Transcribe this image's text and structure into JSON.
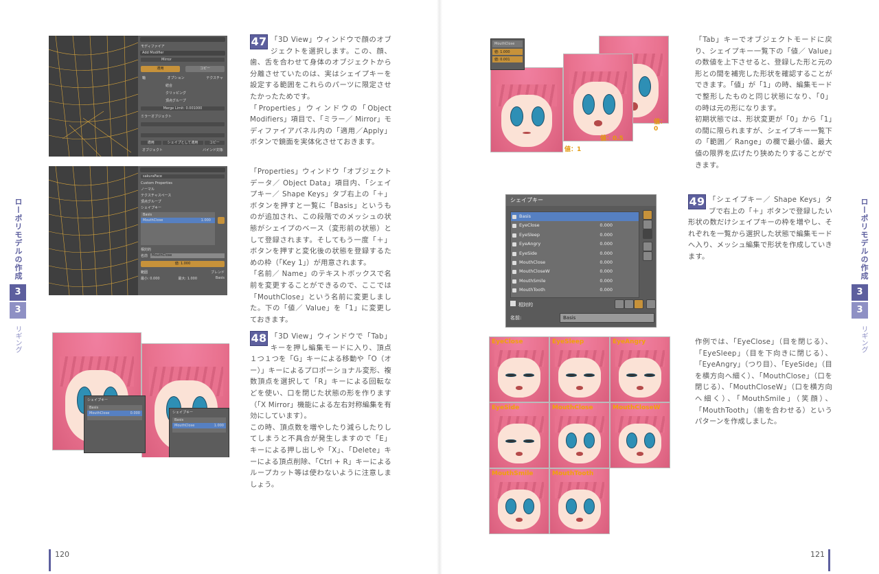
{
  "left_page": {
    "page_number": "120",
    "side_title": "ローポリモデルの作成",
    "chapter": "3",
    "section": "3",
    "side_subtitle": "リギング",
    "step47": {
      "number": "47",
      "para1": "「3D View」ウィンドウで顔のオブジェクトを選択します。この、顔、歯、舌を合わせて身体のオブジェクトから分離させていたのは、実はシェイプキーを設定する範囲をこれらのパーツに限定させたかったためです。",
      "para2": "「Properties」ウィンドウの「Object Modifiers」項目で、「ミラー／ Mirror」モディファイアパネル内の「適用／Apply」ボタンで鏡面を実体化させておきます。"
    },
    "step47b": {
      "para1": "「Properties」ウィンドウ「オブジェクトデータ／ Object Data」項目内、「シェイプキー／ Shape Keys」タブ右上の「＋」ボタンを押すと一覧に「Basis」というものが追加され、この段階でのメッシュの状態がシェイプのベース（変形前の状態）として登録されます。そしてもう一度「＋」ボタンを押すと変化後の状態を登録するための枠（「Key 1」）が用意されます。",
      "para2": "「名前／ Name」のテキストボックスで名前を変更することができるので、ここでは「MouthClose」という名前に変更しました。下の「値／ Value」を「1」に変更しておきます。"
    },
    "step48": {
      "number": "48",
      "para1": "「3D View」ウィンドウで「Tab」キーを押し編集モードに入り、頂点１つ１つを「G」キーによる移動や「O（オー）」キーによるプロポーショナル変形、複数頂点を選択して「R」キーによる回転などを使い、口を閉じた状態の形を作ります（「X Mirror」機能による左右対称編集を有効にしています）。",
      "para2": "この時、頂点数を増やしたり減らしたりしてしまうと不具合が発生しますので「E」キーによる押し出しや「X」、「Delete」キーによる頂点削除、「Ctrl + R」キーによるループカット等は使わないように注意しましょう。"
    },
    "ui": {
      "modifier_header": "モディファイア",
      "add_modifier": "Add Modifier",
      "mirror_name": "Mirror",
      "apply": "適用",
      "copy": "コピー",
      "axis": "軸",
      "options": "オプション",
      "texture": "テクスチャ",
      "merge": "結合",
      "clipping": "クリッピング",
      "vertex_group": "頂点グループ",
      "merge_limit": "Merge Limit: 0.001000",
      "mirror_object": "ミラーオブジェクト",
      "shape_apply": "シェイプとして適用",
      "object_label": "オブジェクト",
      "bind_label": "バインド対象",
      "object_name": "sakuraFace",
      "custom_props": "Custom Properties",
      "normals": "ノーマル",
      "texture_space": "テクスチャスペース",
      "vertex_groups": "頂点グループ",
      "shape_keys": "シェイプキー",
      "basis": "Basis",
      "mouth_close": "MouthClose",
      "mouth_value": "1.000",
      "relative": "相対的",
      "name_label": "名前",
      "value_label": "値: 1.000",
      "range_label": "範囲",
      "blend_label": "ブレンド",
      "min_label": "最小: 0.000",
      "max_label": "最大: 1.000",
      "blend_basis": "Basis",
      "shape_key_small": "シェイプキー",
      "value_small": "0.000"
    }
  },
  "right_page": {
    "page_number": "121",
    "side_title": "ローポリモデルの作成",
    "chapter": "3",
    "section": "3",
    "side_subtitle": "リギング",
    "tab_text": {
      "para1": "「Tab」キーでオブジェクトモードに戻り、シェイプキー一覧下の「値／ Value」の数値を上下させると、登録した形と元の形との間を補完した形状を確認することができます。「値」が「1」の時、編集モードで整形したものと同じ状態になり、「0」の時は元の形になります。",
      "para2": "初期状態では、形状変更が「0」から「1」の間に限られますが、シェイプキー一覧下の「範囲／ Range」の欄で最小値、最大値の限界を広げたり狭めたりすることができます。"
    },
    "value_labels": [
      "値：0",
      "値：0.5",
      "値：1"
    ],
    "mini_panel": {
      "name": "MouthClose",
      "value1": "値: 1.000",
      "value2": "値: 0.001",
      "basis": "Basis"
    },
    "step49": {
      "number": "49",
      "para1": "「シェイプキー／ Shape Keys」タブで右上の「＋」ボタンで登録したい形状の数だけシェイプキーの枠を増やし、それぞれを一覧から選択した状態で編集モードへ入り、メッシュ編集で形状を作成していきます。"
    },
    "example_text": "作例では、「EyeClose」（目を閉じる）、「EyeSleep」（目を下向きに閉じる）、「EyeAngry」（つり目）、「EyeSide」（目を横方向へ細く）、「MouthClose」（口を閉じる）、「MouthCloseW」（口を横方向へ細く）、「MouthSmile」（笑顔）、「MouthTooth」（歯を合わせる）というパターンを作成しました。",
    "shape_panel": {
      "header": "シェイプキー",
      "keys": [
        {
          "name": "Basis",
          "value": ""
        },
        {
          "name": "EyeClose",
          "value": "0.000"
        },
        {
          "name": "EyeSleep",
          "value": "0.000"
        },
        {
          "name": "EyeAngry",
          "value": "0.000"
        },
        {
          "name": "EyeSide",
          "value": "0.000"
        },
        {
          "name": "MouthClose",
          "value": "0.000"
        },
        {
          "name": "MouthCloseW",
          "value": "0.000"
        },
        {
          "name": "MouthSmile",
          "value": "0.000"
        },
        {
          "name": "MouthTooth",
          "value": "0.000"
        }
      ],
      "relative": "相対的",
      "name_label": "名前:",
      "name_value": "Basis"
    },
    "face_grid": [
      "EyeClose",
      "EyeSleep",
      "EyeAngry",
      "EyeSide",
      "MouthClose",
      "MouthCloseW",
      "MouthSmile",
      "MouthTooth"
    ]
  },
  "colors": {
    "accent": "#5d5f9e",
    "accent_light": "#8e90c4",
    "hair": "#e9728f",
    "label": "#f0a20a"
  }
}
